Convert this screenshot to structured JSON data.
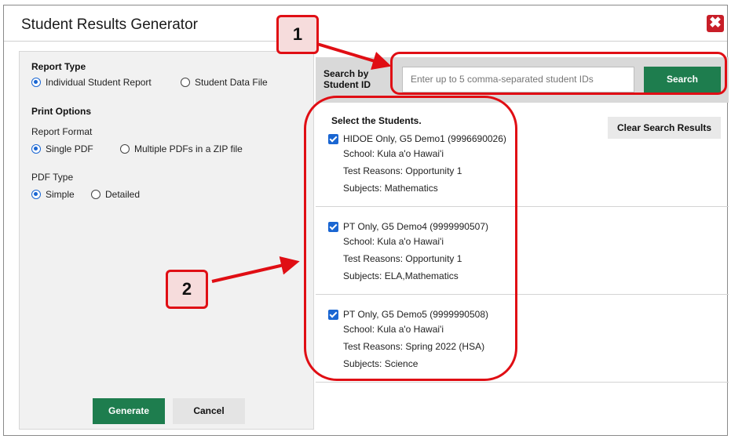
{
  "dialog": {
    "title": "Student Results Generator",
    "close_icon": "close-icon"
  },
  "report_type": {
    "heading": "Report Type",
    "options": [
      {
        "label": "Individual Student Report",
        "selected": true
      },
      {
        "label": "Student Data File",
        "selected": false
      }
    ]
  },
  "print_options": {
    "heading": "Print Options",
    "report_format": {
      "label": "Report Format",
      "options": [
        {
          "label": "Single PDF",
          "selected": true
        },
        {
          "label": "Multiple PDFs in a ZIP file",
          "selected": false
        }
      ]
    },
    "pdf_type": {
      "label": "PDF Type",
      "options": [
        {
          "label": "Simple",
          "selected": true
        },
        {
          "label": "Detailed",
          "selected": false
        }
      ]
    }
  },
  "buttons": {
    "generate": "Generate",
    "cancel": "Cancel"
  },
  "search": {
    "label_line1": "Search by",
    "label_line2": "Student ID",
    "placeholder": "Enter up to 5 comma-separated student IDs",
    "button": "Search"
  },
  "results": {
    "heading": "Select the Students.",
    "clear_button": "Clear Search Results",
    "students": [
      {
        "name": "HIDOE Only, G5 Demo1 (9996690026)",
        "school": "School: Kula a'o Hawai'i",
        "reasons": "Test Reasons: Opportunity 1",
        "subjects": "Subjects: Mathematics",
        "checked": true
      },
      {
        "name": "PT Only, G5 Demo4 (9999990507)",
        "school": "School: Kula a'o Hawai'i",
        "reasons": "Test Reasons: Opportunity 1",
        "subjects": "Subjects: ELA,Mathematics",
        "checked": true
      },
      {
        "name": "PT Only, G5 Demo5 (9999990508)",
        "school": "School: Kula a'o Hawai'i",
        "reasons": "Test Reasons: Spring 2022 (HSA)",
        "subjects": "Subjects: Science",
        "checked": true
      }
    ]
  },
  "callouts": {
    "one": "1",
    "two": "2"
  },
  "colors": {
    "accent_green": "#1e7d4e",
    "close_red": "#c81e28",
    "callout_red": "#e00e14",
    "radio_blue": "#1a66d2"
  }
}
